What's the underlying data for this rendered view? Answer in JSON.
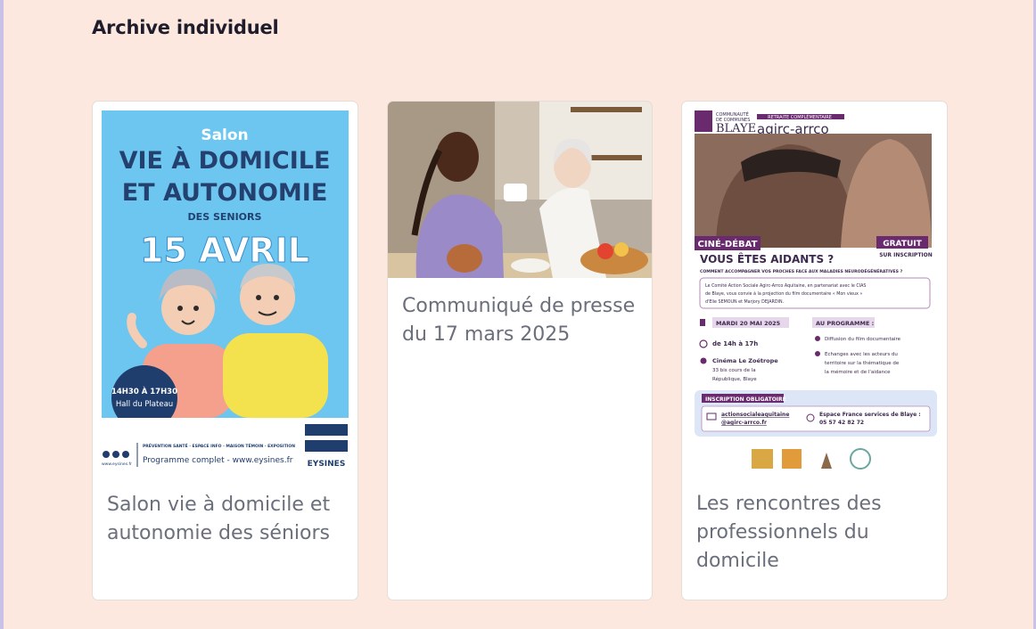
{
  "page": {
    "section_title": "Archive individuel"
  },
  "cards": [
    {
      "title": "Salon vie à domicile et autonomie des séniors",
      "poster": {
        "kicker": "Salon",
        "headline_1": "VIE À DOMICILE",
        "headline_2": "ET AUTONOMIE",
        "subline": "DES SENIORS",
        "date": "15 AVRIL",
        "badge_time": "14H30 À 17H30",
        "badge_place": "Hall du Plateau",
        "footer_tags": "PRÉVENTION SANTÉ · ESPACE INFO · MAISON TÉMOIN · EXPOSITION",
        "footer_program": "Programme complet - www.eysines.fr",
        "footer_site": "www.eysines.fr",
        "brand": "EYSINES"
      }
    },
    {
      "title": "Communiqué de presse du 17 mars 2025"
    },
    {
      "title": "Les rencontres des professionnels du domicile",
      "poster": {
        "logo_left_1": "COMMUNAUTÉ",
        "logo_left_2": "DE COMMUNES",
        "logo_left_3": "BLAYE",
        "logo_right_tag": "RETRAITE COMPLÉMENTAIRE",
        "logo_right": "agirc-arrco",
        "ribbon_left": "CINÉ-DÉBAT",
        "ribbon_right": "GRATUIT",
        "ribbon_right_sub": "SUR INSCRIPTION",
        "heading": "VOUS ÊTES AIDANTS ?",
        "subheading": "COMMENT ACCOMPAGNER VOS PROCHES FACE AUX MALADIES NEURODÉGÉNÉRATIVES ?",
        "intro_1": "Le Comité Action Sociale Agirc-Arrco Aquitaine, en partenariat avec le CIAS",
        "intro_2": "de Blaye, vous convie à la projection du film documentaire « Mon vieux »",
        "intro_3": "d'Elie SEMOUN et Marjory DEJARDIN.",
        "date_tag": "MARDI 20 MAI 2025",
        "time": "de 14h à 17h",
        "venue": "Cinéma Le Zoétrope",
        "address_1": "33 bis cours de la",
        "address_2": "République, Blaye",
        "program_tag": "AU PROGRAMME :",
        "program_1": "Diffusion du film documentaire",
        "program_2a": "Echanges avec les acteurs du",
        "program_2b": "territoire sur la thématique de",
        "program_2c": "la mémoire et de l'aidance",
        "signup_tag": "INSCRIPTION OBLIGATOIRE",
        "email_1": "actionsocialeaquitaine",
        "email_2": "@agirc-arrco.fr",
        "phone_label": "Espace France services de Blaye :",
        "phone": "05 57 42 82 72"
      }
    }
  ]
}
